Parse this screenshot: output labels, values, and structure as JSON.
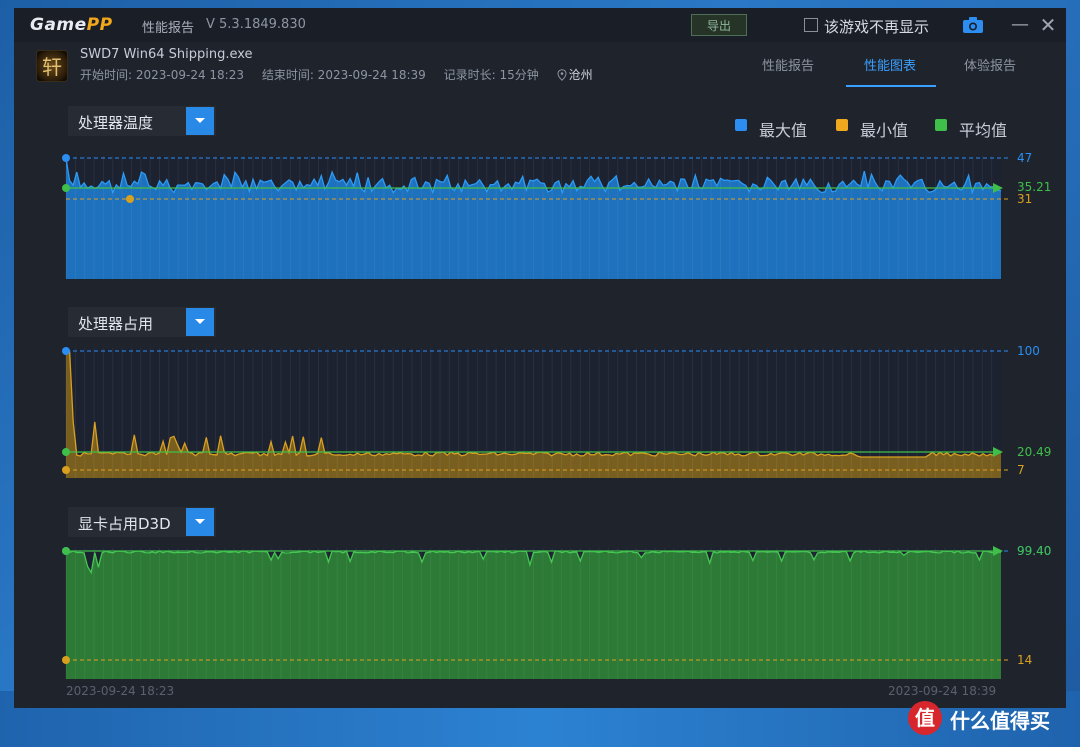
{
  "app": {
    "logo_prefix": "Game",
    "logo_suffix": "PP",
    "title": "性能报告",
    "version": "V 5.3.1849.830",
    "export_label": "导出",
    "no_show_label": "该游戏不再显示",
    "minimize_glyph": "—",
    "close_glyph": "✕"
  },
  "session": {
    "app_icon_glyph": "轩",
    "process_name": "SWD7 Win64 Shipping.exe",
    "start": "开始时间: 2023-09-24 18:23",
    "end": "结束时间: 2023-09-24 18:39",
    "duration": "记录时长: 15分钟",
    "city": "沧州"
  },
  "tabs": [
    {
      "label": "性能报告",
      "active": false
    },
    {
      "label": "性能图表",
      "active": true
    },
    {
      "label": "体验报告",
      "active": false
    }
  ],
  "legend": [
    {
      "label": "最大值",
      "color": "#2b8ef0"
    },
    {
      "label": "最小值",
      "color": "#f0a81e"
    },
    {
      "label": "平均值",
      "color": "#3fbf4a"
    }
  ],
  "charts": [
    {
      "title": "处理器温度",
      "max_label": "47",
      "avg_label": "35.21",
      "min_label": "31"
    },
    {
      "title": "处理器占用",
      "max_label": "100",
      "avg_label": "20.49",
      "min_label": "7"
    },
    {
      "title": "显卡占用D3D",
      "max_label": "99.40",
      "avg_label": "99.40",
      "min_label": "14"
    }
  ],
  "chart_data": [
    {
      "type": "area",
      "title": "处理器温度",
      "ylim": [
        31,
        47
      ],
      "series": [
        {
          "values_summary": {
            "max": 47,
            "min": 31,
            "avg": 35.21
          }
        }
      ],
      "color": "#1f8ae8"
    },
    {
      "type": "area",
      "title": "处理器占用",
      "ylim": [
        7,
        100
      ],
      "series": [
        {
          "values_summary": {
            "max": 100,
            "min": 7,
            "avg": 20.49
          }
        }
      ],
      "color": "#d9a020"
    },
    {
      "type": "area",
      "title": "显卡占用D3D",
      "ylim": [
        14,
        99.4
      ],
      "series": [
        {
          "values_summary": {
            "max": 99.4,
            "min": 14,
            "avg": 99.4
          }
        }
      ],
      "color": "#3fb34a"
    }
  ],
  "timeline": {
    "start": "2023-09-24 18:23",
    "end": "2023-09-24 18:39"
  },
  "watermark": {
    "glyph": "值",
    "text": "什么值得买"
  }
}
